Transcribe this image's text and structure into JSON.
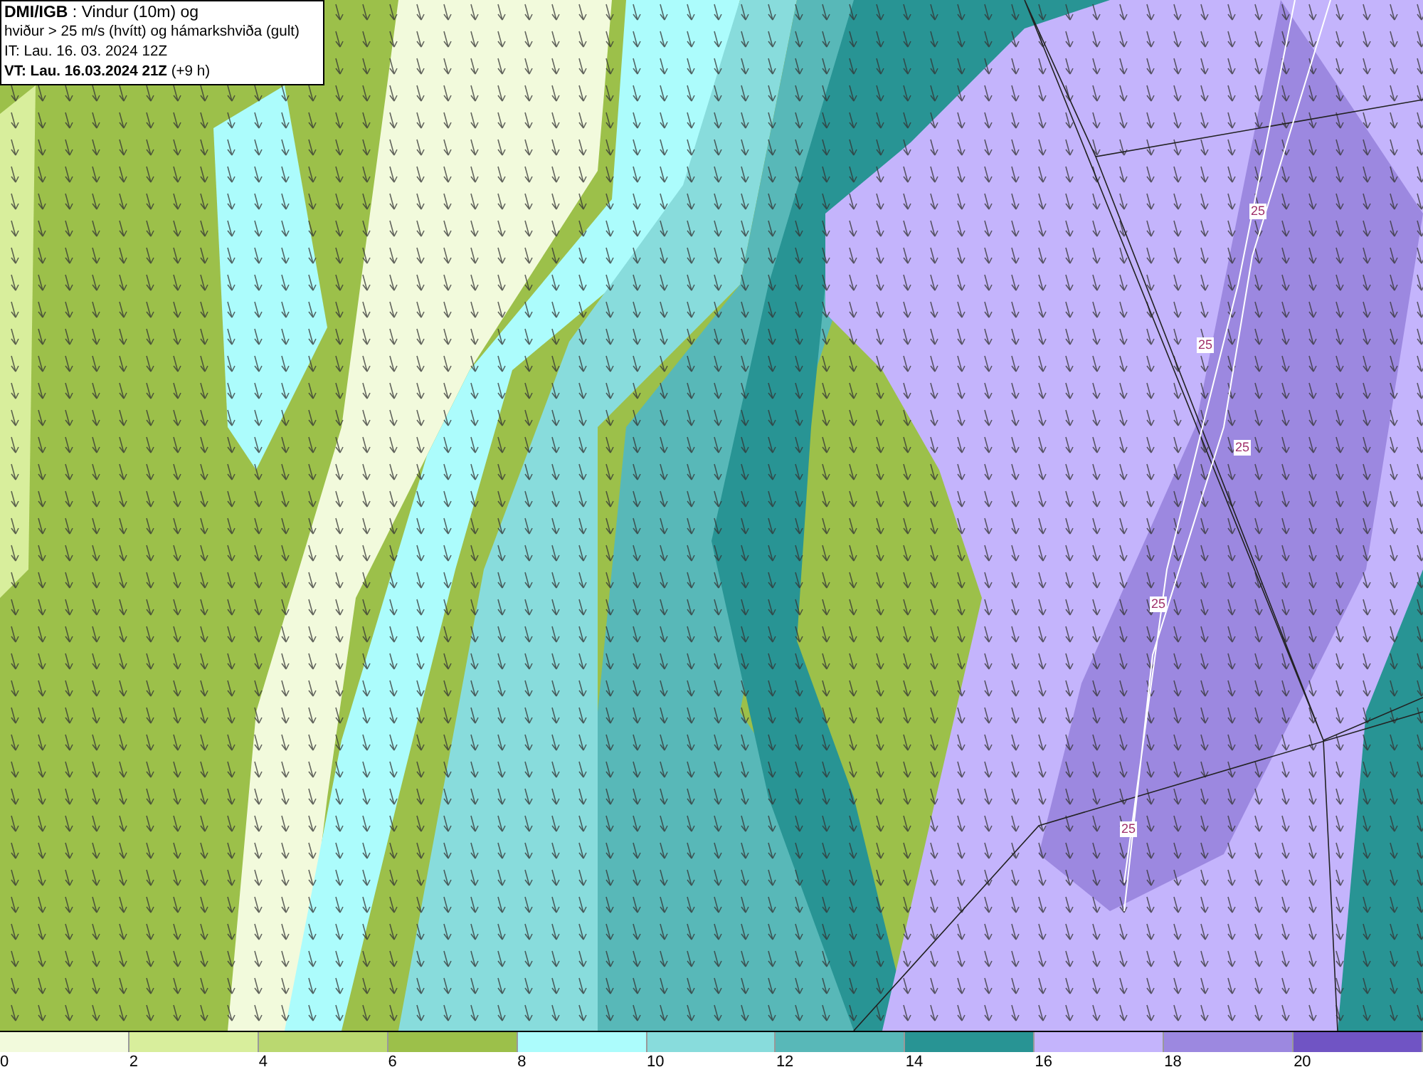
{
  "title_box": {
    "lines": [
      "**DMI/IGB** : Vindur (10m) og",
      "hviður > 25 m/s (hvítt) og hámarkshviða (gult)",
      "IT: Lau. 16. 03. 2024 12Z",
      "**VT: Lau. 16.03.2024 21Z** (+9 h)"
    ]
  },
  "map": {
    "contour_labels": [
      "25",
      "25",
      "25",
      "25",
      "25"
    ]
  },
  "legend": [
    {
      "label": "0",
      "color": "#f2fadc"
    },
    {
      "label": "2",
      "color": "#d8ee9c"
    },
    {
      "label": "4",
      "color": "#bad870"
    },
    {
      "label": "6",
      "color": "#9cc04a"
    },
    {
      "label": "8",
      "color": "#acfcfc"
    },
    {
      "label": "10",
      "color": "#88dcdc"
    },
    {
      "label": "12",
      "color": "#58b8b8"
    },
    {
      "label": "14",
      "color": "#289494"
    },
    {
      "label": "16",
      "color": "#c4b4fc"
    },
    {
      "label": "18",
      "color": "#9c88e0"
    },
    {
      "label": "20",
      "color": "#7054c4"
    }
  ]
}
